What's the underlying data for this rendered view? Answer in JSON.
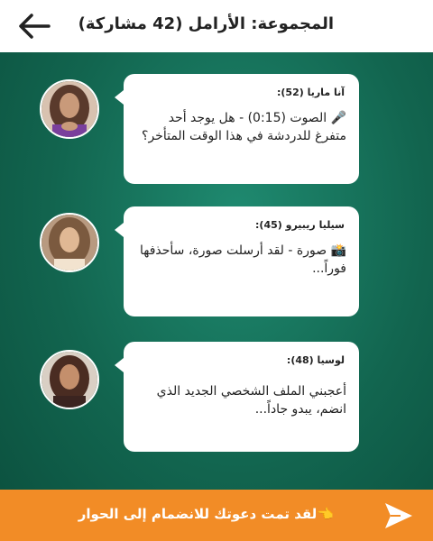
{
  "header": {
    "title": "المجموعة: الأرامل (42 مشاركة)",
    "back_icon": "arrow-left-icon"
  },
  "messages": [
    {
      "sender": "آنا ماريا (52):",
      "text": "🎤 الصوت (0:15) - هل يوجد أحد متفرغ للدردشة في هذا الوقت المتأخر؟",
      "avatar_colors": [
        "#5a3a2c",
        "#c99a7a",
        "#7a3f9c"
      ]
    },
    {
      "sender": "سيليا ريبيرو (45):",
      "text": "📸 صورة - لقد أرسلت صورة، سأحذفها فوراً...",
      "avatar_colors": [
        "#7b5a3f",
        "#e0b894",
        "#f2e3cf"
      ]
    },
    {
      "sender": "لوسيا (48):",
      "text": "أعجبني الملف الشخصي الجديد الذي انضم، يبدو جاداً...",
      "avatar_colors": [
        "#4a2c22",
        "#c48f6c",
        "#3b2420"
      ]
    }
  ],
  "footer": {
    "invite_text": "👈لقد تمت دعوتك للانضمام إلى الحوار",
    "send_icon": "send-icon"
  },
  "colors": {
    "accent": "#f28c26",
    "background": "#137058",
    "bubble": "#ffffff"
  }
}
